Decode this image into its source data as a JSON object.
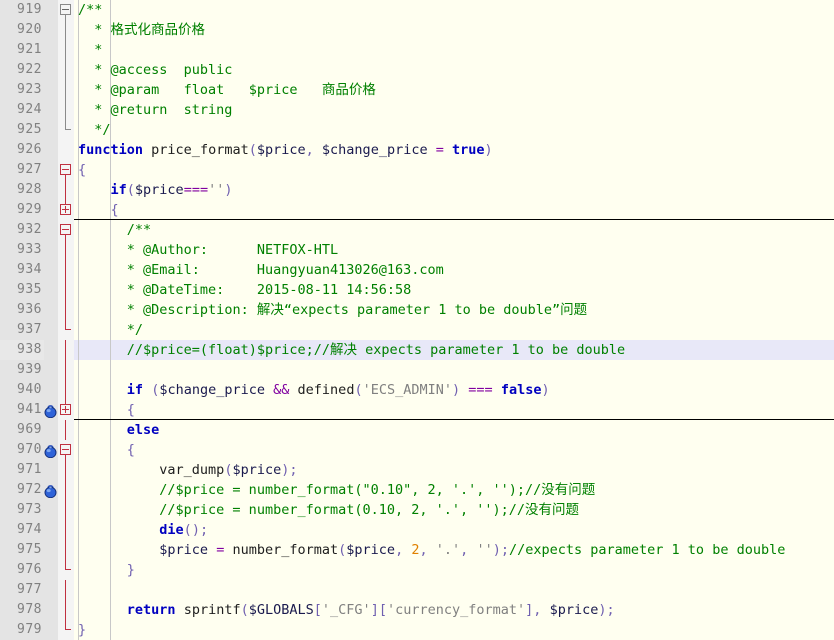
{
  "editor": {
    "name": "code-editor",
    "language": "PHP",
    "colors": {
      "background": "#FFFFF0",
      "gutter_background": "#E4E4E4",
      "gutter_number": "#808080",
      "current_line_highlight": "#E8E8F8",
      "comment": "#008000",
      "keyword": "#0000C0",
      "operator": "#8000A0",
      "string": "#808080",
      "number": "#E08000",
      "fold_marker": "#C03040",
      "fold_separator": "#000000"
    },
    "icons": {
      "bookmark": "bookmark-sphere-icon",
      "fold_collapse": "fold-minus-icon",
      "fold_expand": "fold-plus-icon"
    },
    "lines": [
      {
        "num": "919",
        "fold": "minus-gray",
        "bookmark": false,
        "text": "/**"
      },
      {
        "num": "920",
        "fold": "line-gray",
        "bookmark": false,
        "text": "  * 格式化商品价格"
      },
      {
        "num": "921",
        "fold": "line-gray",
        "bookmark": false,
        "text": "  *"
      },
      {
        "num": "922",
        "fold": "line-gray",
        "bookmark": false,
        "text": "  * @access  public"
      },
      {
        "num": "923",
        "fold": "line-gray",
        "bookmark": false,
        "text": "  * @param   float   $price   商品价格"
      },
      {
        "num": "924",
        "fold": "line-gray",
        "bookmark": false,
        "text": "  * @return  string"
      },
      {
        "num": "925",
        "fold": "tick-gray",
        "bookmark": false,
        "text": "  */"
      },
      {
        "num": "926",
        "fold": "none",
        "bookmark": false,
        "text": "function price_format($price, $change_price = true)"
      },
      {
        "num": "927",
        "fold": "minus",
        "bookmark": false,
        "text": "{"
      },
      {
        "num": "928",
        "fold": "line",
        "bookmark": false,
        "text": "    if($price==='')"
      },
      {
        "num": "929",
        "fold": "plus",
        "bookmark": false,
        "text": "    {",
        "separator_below": true
      },
      {
        "num": "932",
        "fold": "minus",
        "bookmark": false,
        "text": "      /**"
      },
      {
        "num": "933",
        "fold": "line",
        "bookmark": false,
        "text": "      * @Author:      NETFOX-HTL"
      },
      {
        "num": "934",
        "fold": "line",
        "bookmark": false,
        "text": "      * @Email:       Huangyuan413026@163.com"
      },
      {
        "num": "935",
        "fold": "line",
        "bookmark": false,
        "text": "      * @DateTime:    2015-08-11 14:56:58"
      },
      {
        "num": "936",
        "fold": "line",
        "bookmark": false,
        "text": "      * @Description: 解决“expects parameter 1 to be double”问题"
      },
      {
        "num": "937",
        "fold": "tick",
        "bookmark": false,
        "text": "      */"
      },
      {
        "num": "938",
        "fold": "line",
        "bookmark": false,
        "highlight": true,
        "text": "      //$price=(float)$price;//解决 expects parameter 1 to be double"
      },
      {
        "num": "939",
        "fold": "line",
        "bookmark": false,
        "text": ""
      },
      {
        "num": "940",
        "fold": "line",
        "bookmark": false,
        "text": "      if ($change_price && defined('ECS_ADMIN') === false)"
      },
      {
        "num": "941",
        "fold": "plus",
        "bookmark": true,
        "text": "      {",
        "separator_below": true
      },
      {
        "num": "969",
        "fold": "line",
        "bookmark": false,
        "text": "      else"
      },
      {
        "num": "970",
        "fold": "minus",
        "bookmark": true,
        "text": "      {"
      },
      {
        "num": "971",
        "fold": "line",
        "bookmark": false,
        "text": "          var_dump($price);"
      },
      {
        "num": "972",
        "fold": "line",
        "bookmark": true,
        "text": "          //$price = number_format(\"0.10\", 2, '.', '');//没有问题"
      },
      {
        "num": "973",
        "fold": "line",
        "bookmark": false,
        "text": "          //$price = number_format(0.10, 2, '.', '');//没有问题"
      },
      {
        "num": "974",
        "fold": "line",
        "bookmark": false,
        "text": "          die();"
      },
      {
        "num": "975",
        "fold": "line",
        "bookmark": false,
        "text": "          $price = number_format($price, 2, '.', '');//expects parameter 1 to be double"
      },
      {
        "num": "976",
        "fold": "tick",
        "bookmark": false,
        "text": "      }"
      },
      {
        "num": "977",
        "fold": "line",
        "bookmark": false,
        "text": ""
      },
      {
        "num": "978",
        "fold": "line",
        "bookmark": false,
        "text": "      return sprintf($GLOBALS['_CFG']['currency_format'], $price);"
      },
      {
        "num": "979",
        "fold": "tick",
        "bookmark": false,
        "text": "}"
      }
    ]
  }
}
